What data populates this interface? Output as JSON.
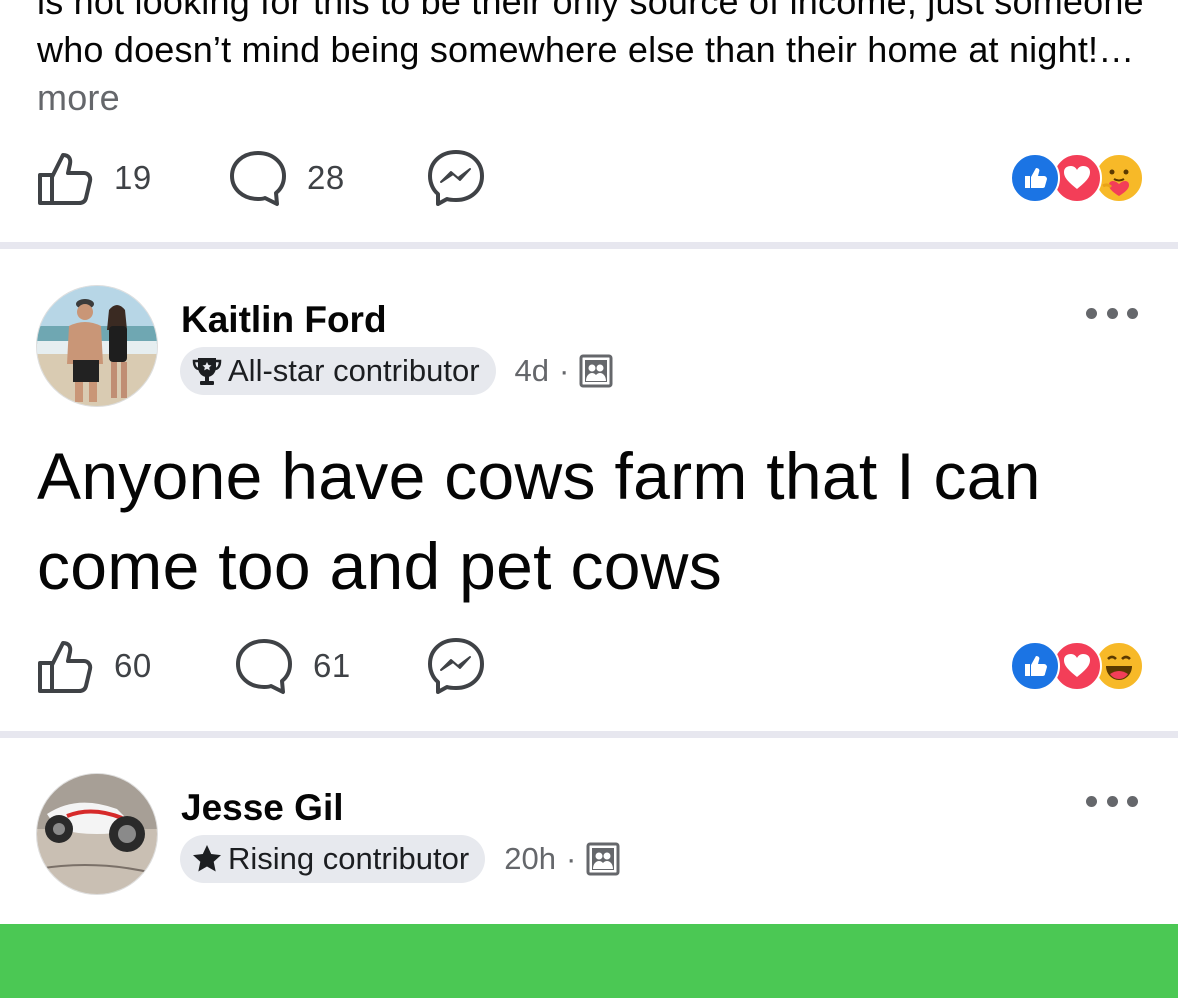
{
  "posts": [
    {
      "text": "is not looking for this to be their only source of income, just someone who doesn’t mind being somewhere else than their home at night!…",
      "more_label": "more",
      "likes": "19",
      "comments": "28",
      "reactions": [
        "like-reaction",
        "love-reaction",
        "care-reaction"
      ]
    },
    {
      "author": "Kaitlin Ford",
      "badge": "All-star contributor",
      "badge_icon": "trophy-icon",
      "time": "4d",
      "separator": "·",
      "audience_icon": "group-icon",
      "text": "Anyone have cows farm that I can come too and pet cows",
      "likes": "60",
      "comments": "61",
      "reactions": [
        "like-reaction",
        "love-reaction",
        "haha-reaction"
      ]
    },
    {
      "author": "Jesse Gil",
      "badge": "Rising contributor",
      "badge_icon": "star-icon",
      "time": "20h",
      "separator": "·",
      "audience_icon": "group-icon"
    }
  ],
  "colors": {
    "like_blue": "#1b74e4",
    "love_red": "#f33e58",
    "emoji_yellow": "#f7b928",
    "divider": "#e7e7ef",
    "bottom_bar_green": "#4bc854",
    "secondary_text": "#65676b"
  }
}
